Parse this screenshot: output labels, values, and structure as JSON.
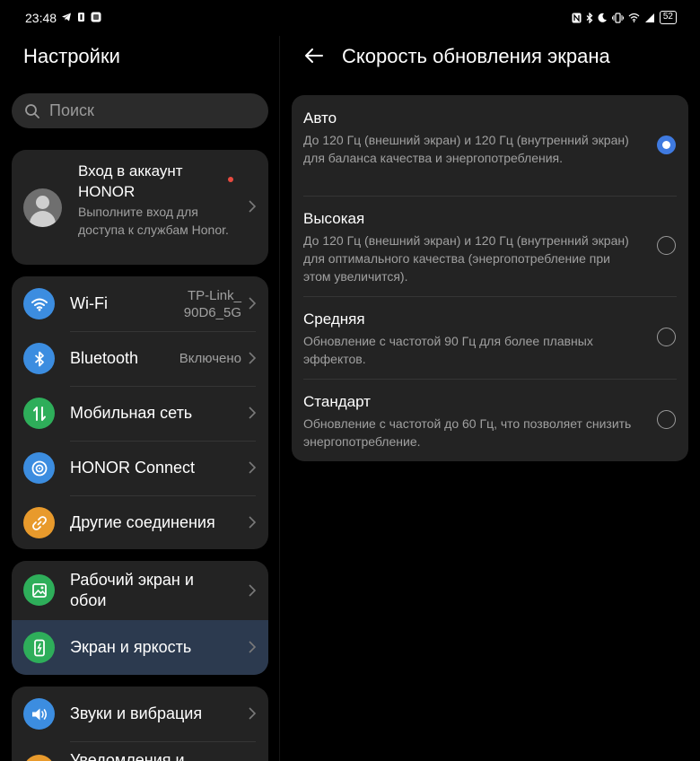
{
  "status_bar": {
    "time": "23:48",
    "battery": "52"
  },
  "left": {
    "title": "Настройки",
    "search_placeholder": "Поиск",
    "account": {
      "title": "Вход в аккаунт HONOR",
      "subtitle": "Выполните вход для доступа к службам Honor."
    },
    "group1": [
      {
        "label": "Wi-Fi",
        "value": "TP-Link_ 90D6_5G",
        "icon": "wifi-icon",
        "color": "#3c8de0"
      },
      {
        "label": "Bluetooth",
        "value": "Включено",
        "icon": "bluetooth-icon",
        "color": "#3c8de0"
      },
      {
        "label": "Мобильная сеть",
        "value": "",
        "icon": "mobile-data-icon",
        "color": "#2eae5a"
      },
      {
        "label": "HONOR Connect",
        "value": "",
        "icon": "honor-connect-icon",
        "color": "#3c8de0"
      },
      {
        "label": "Другие соединения",
        "value": "",
        "icon": "link-icon",
        "color": "#e89a2c"
      }
    ],
    "group2": [
      {
        "label": "Рабочий экран и обои",
        "icon": "wallpaper-icon",
        "color": "#2eae5a"
      },
      {
        "label": "Экран и яркость",
        "icon": "display-icon",
        "color": "#2eae5a"
      }
    ],
    "group3": [
      {
        "label": "Звуки и вибрация",
        "icon": "sound-icon",
        "color": "#3c8de0"
      },
      {
        "label": "Уведомления и",
        "icon": "notifications-icon",
        "color": "#e89a2c"
      }
    ]
  },
  "right": {
    "title": "Скорость обновления экрана",
    "options": [
      {
        "title": "Авто",
        "desc": "До 120 Гц (внешний экран) и 120 Гц (внутренний экран) для баланса качества и энергопотребления.",
        "selected": true
      },
      {
        "title": "Высокая",
        "desc": "До 120 Гц (внешний экран) и 120 Гц (внутренний экран) для оптимального качества (энергопотребление при этом увеличится).",
        "selected": false
      },
      {
        "title": "Средняя",
        "desc": "Обновление с частотой 90 Гц для более плавных эффектов.",
        "selected": false
      },
      {
        "title": "Стандарт",
        "desc": "Обновление с частотой до 60 Гц, что позволяет снизить энергопотребление.",
        "selected": false
      }
    ]
  },
  "colors": {
    "accent": "#3f7ae0",
    "selected_row": "#2c3a4f",
    "card": "#232323",
    "notification_dot": "#e84a3f"
  }
}
